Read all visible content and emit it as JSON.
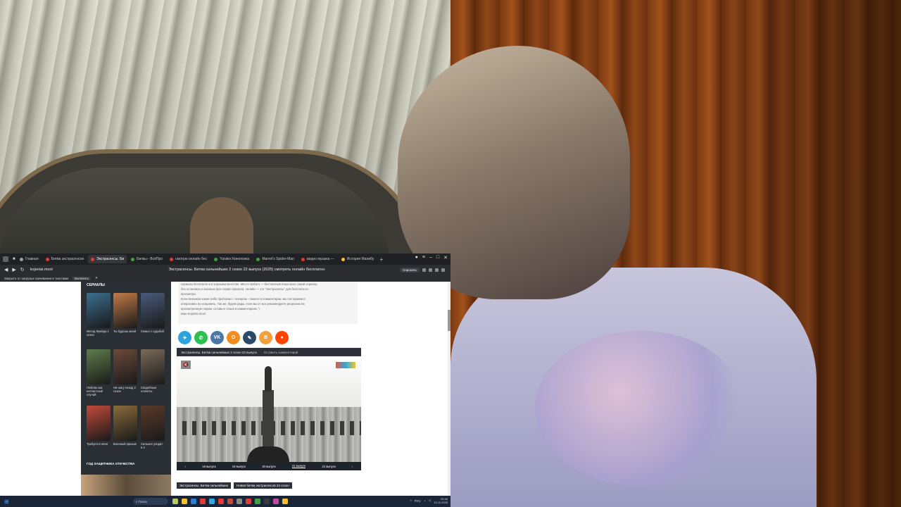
{
  "browser": {
    "tabs": [
      {
        "label": "Главная",
        "color": "#9aa0a6"
      },
      {
        "label": "Битва экстрасенсов",
        "color": "#e53935"
      },
      {
        "label": "Экстрасенсы. Би",
        "color": "#e53935",
        "active": true
      },
      {
        "label": "Битвы - ВсёПро",
        "color": "#43a047"
      },
      {
        "label": "смотрю онлайн бес",
        "color": "#e53935"
      },
      {
        "label": "Yandex Кинопоиск",
        "color": "#43a047"
      },
      {
        "label": "Marvel's Spider-Man",
        "color": "#43a047"
      },
      {
        "label": "видео музыка —",
        "color": "#e53935"
      },
      {
        "label": "История Малибу",
        "color": "#fbc02d"
      }
    ],
    "new_tab": "+",
    "url": "kojsetai.mool",
    "page_title": "Экстрасенсы. Битва сильнейших 2 сезон 22 выпуск (2025) смотреть онлайн бесплатно",
    "ask_button": "Спросить",
    "infobar_text": "Закрыто от загрузка скачивания и текстами",
    "infobar_button": "Включить"
  },
  "sidebar": {
    "title": "СЕРИАЛЫ",
    "posters": [
      {
        "caption": "Метод Фрейда 1 сезон",
        "color": "#3b6e8f"
      },
      {
        "caption": "Ты будешь моей",
        "color": "#c27a48"
      },
      {
        "caption": "Семья с судьбой",
        "color": "#4a5a7a"
      },
      {
        "caption": "Любовь как несчастный случай",
        "color": "#5e7c4a"
      },
      {
        "caption": "Ни шагу назад 2 сезон",
        "color": "#6b4a3a"
      },
      {
        "caption": "Свадебные хлопоты",
        "color": "#7a6a5a"
      },
      {
        "caption": "Требуется няня",
        "color": "#c24a3a"
      },
      {
        "caption": "Военный призыв",
        "color": "#8a6a3a"
      },
      {
        "caption": "Сильнее уходит в 4",
        "color": "#5a3a2a"
      }
    ],
    "footer": "ГОД ЗАЩИТНИКА ОТЕЧЕСТВА"
  },
  "content": {
    "description": [
      "сериалы бесплатно и в хорошем качестве. Место любого — бесплатный показ всех серий сериала",
      "без остановок и шаговых (все серии сериала). онлайн — это \"Экстрасенсы\" для бесплатного",
      "просмотра.",
      "Если возникли какие-либо проблемы с плеером - пишите в комментарии, мы постараемся",
      "оперативно их исправить. Так же, будем рады, если вы от все рекомендуете рецензию на",
      "просмотренную серию, оставьте отзыв в комментариях :)",
      "Ваш Kojsetai.mool"
    ],
    "share": [
      {
        "name": "telegram",
        "glyph": "✈",
        "color": "#2aa3df"
      },
      {
        "name": "whatsapp",
        "glyph": "✆",
        "color": "#2fbe52"
      },
      {
        "name": "vk",
        "glyph": "VK",
        "color": "#4a76a8"
      },
      {
        "name": "odnoklassniki",
        "glyph": "О",
        "color": "#f28c1e"
      },
      {
        "name": "livejournal",
        "glyph": "✎",
        "color": "#2c4a66"
      },
      {
        "name": "blogger",
        "glyph": "B",
        "color": "#f2a13a"
      },
      {
        "name": "reddit",
        "glyph": "●",
        "color": "#ff4500"
      }
    ],
    "player_title": "Экстрасенсы. Битва сильнейших 2 сезон 22 выпуск",
    "player_comment": "Оставить комментарий",
    "mute_glyph": "🔇",
    "episodes": [
      "18 выпуск",
      "19 выпуск",
      "20 выпуск",
      "21 выпуск",
      "22 выпуск"
    ],
    "tags": [
      "Экстрасенсы. Битва сильнейших",
      "Новая битва экстрасенсов 24 сезон"
    ]
  },
  "taskbar": {
    "search_placeholder": "Поиск",
    "icons": [
      "#b8c86a",
      "#f2c230",
      "#2f7fd0",
      "#e53935",
      "#2fa9e0",
      "#e53935",
      "#c24a3a",
      "#8a8a8a",
      "#e53935",
      "#43a047",
      "#3a3a3a",
      "#c24a9a",
      "#fbc02d"
    ],
    "lang": "РУС",
    "time": "22:46",
    "date": "13.10.2025"
  }
}
